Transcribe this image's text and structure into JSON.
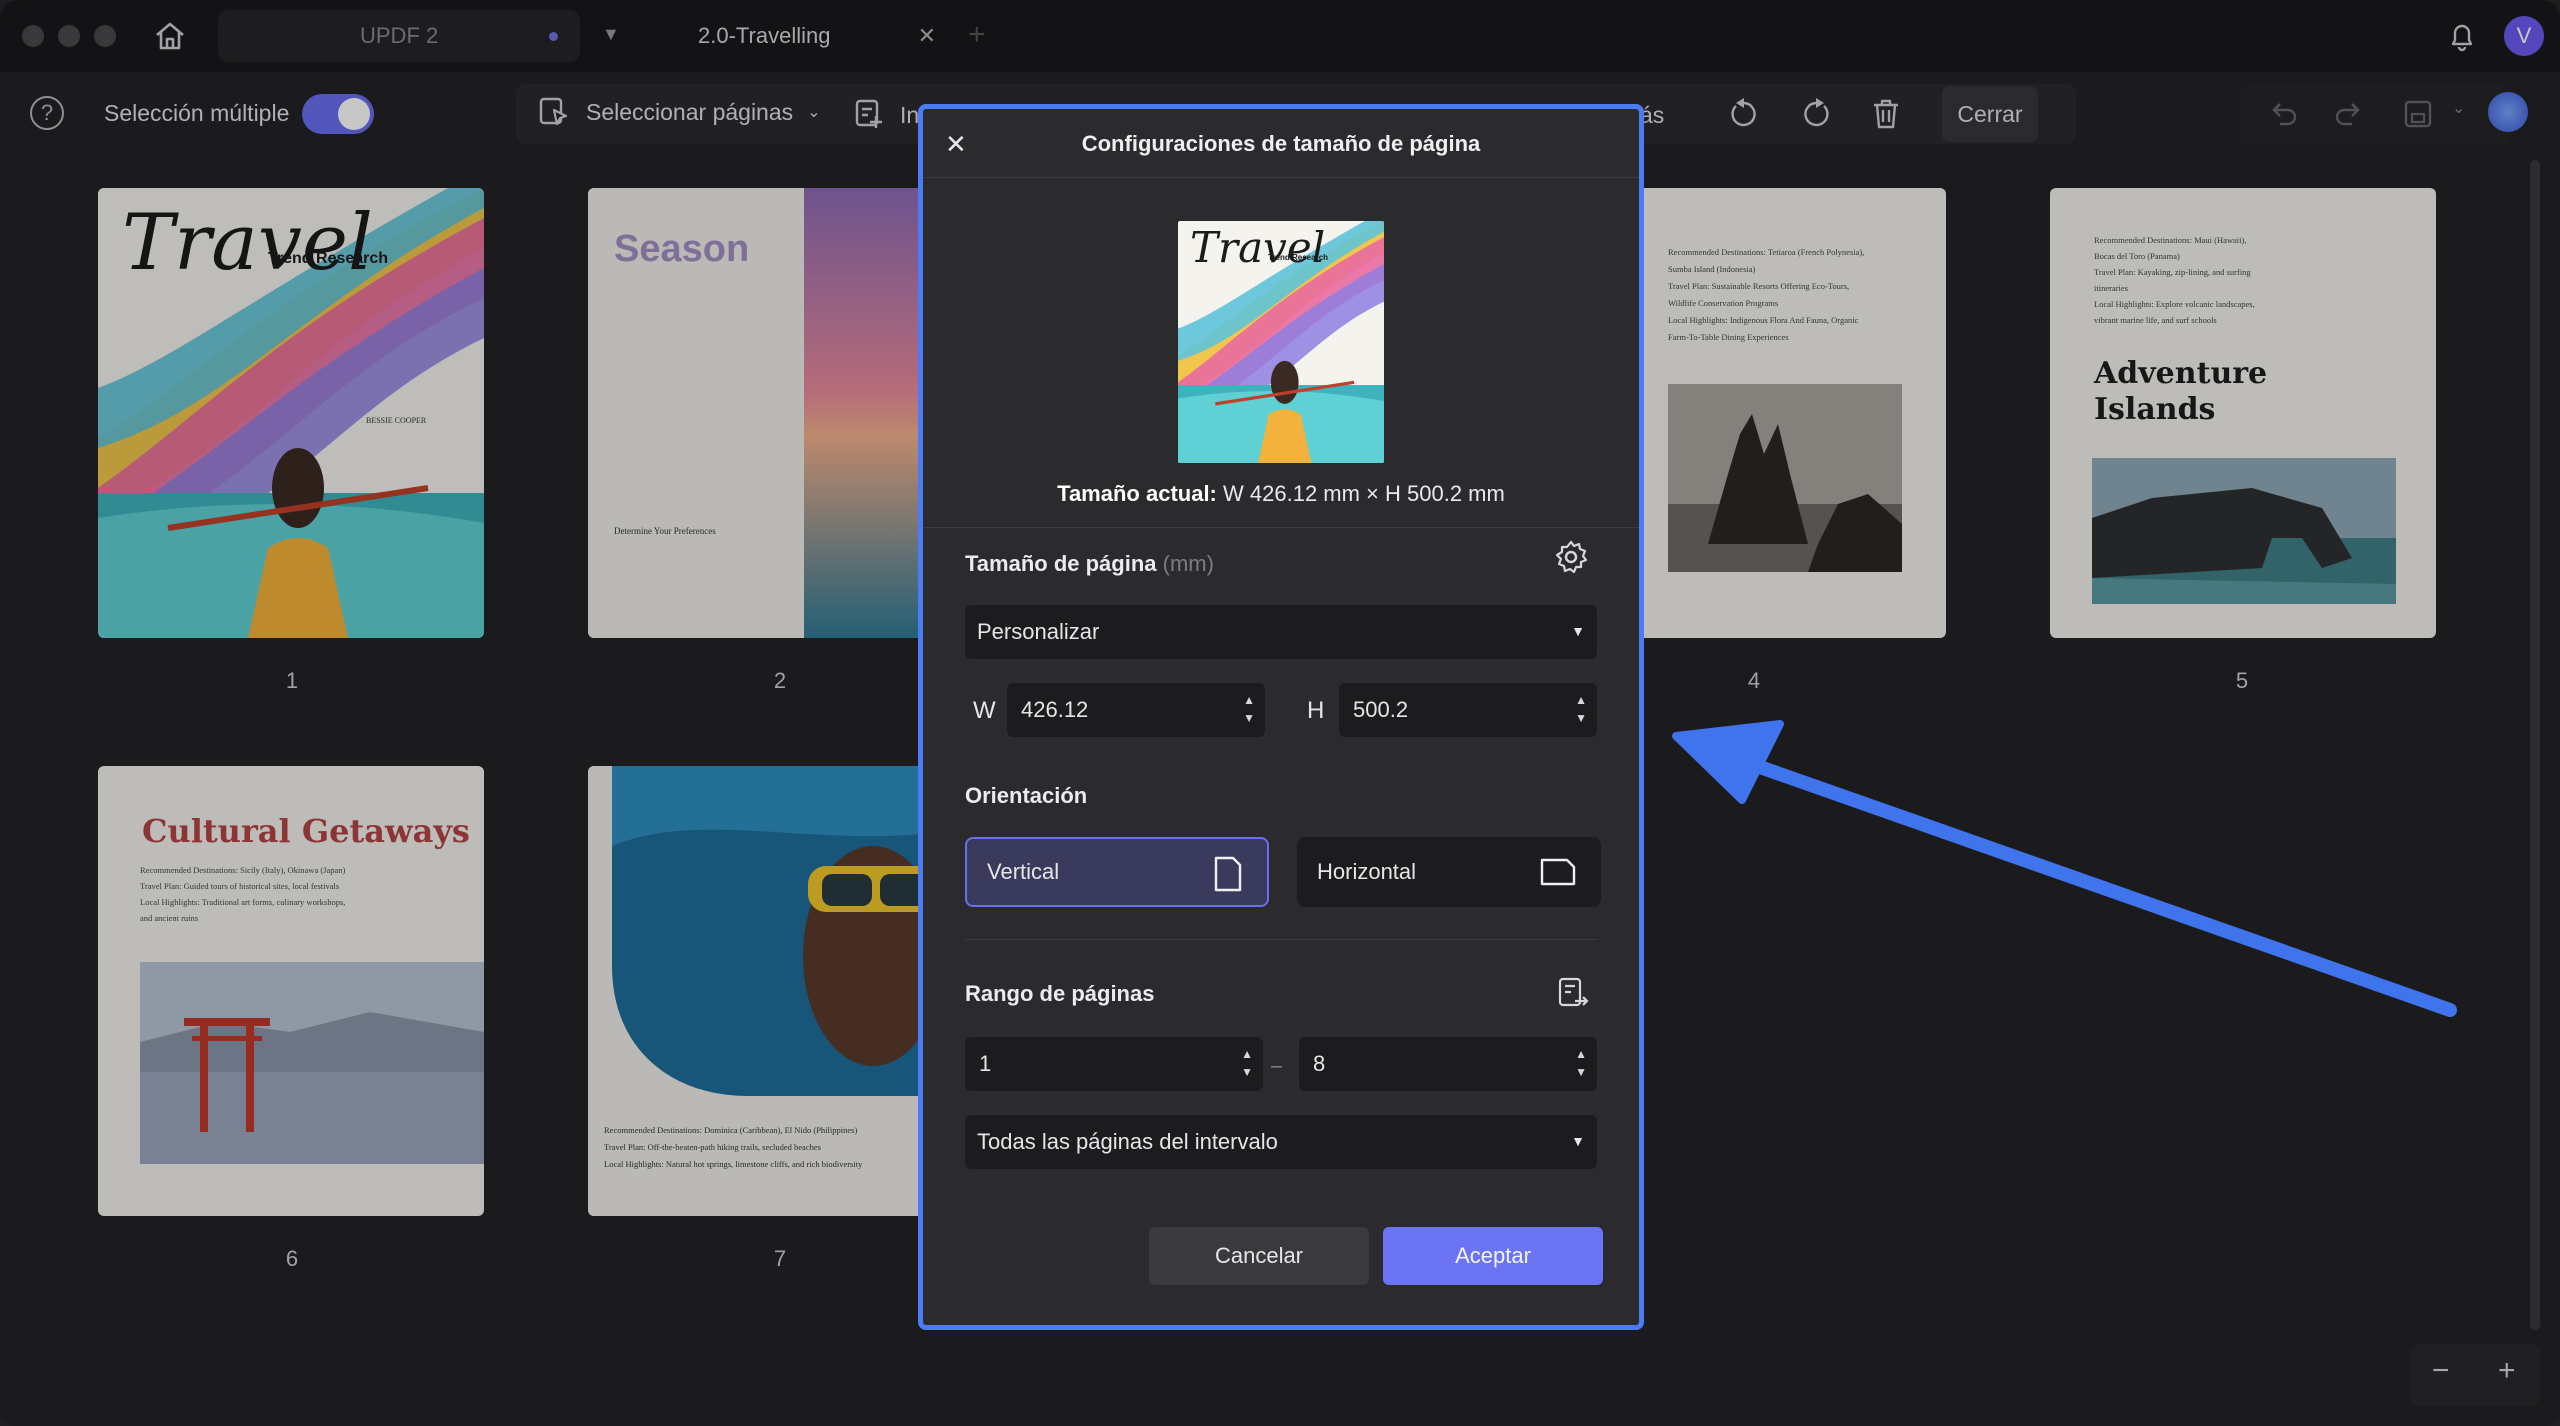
{
  "titlebar": {
    "tabs": [
      {
        "label": "UPDF 2"
      },
      {
        "label": "2.0-Travelling"
      }
    ],
    "avatar_initial": "V"
  },
  "toolbar": {
    "multi_select_label": "Selección múltiple",
    "select_pages_label": "Seleccionar páginas",
    "insert_partial": "In",
    "more_partial": "ás",
    "close_label": "Cerrar"
  },
  "pages": [
    {
      "number": "1"
    },
    {
      "number": "2"
    },
    {
      "number": "4"
    },
    {
      "number": "5"
    },
    {
      "number": "6"
    },
    {
      "number": "7"
    }
  ],
  "page_content": {
    "p1_script_title": "Travel",
    "p1_trend": "Trend Research",
    "p1_author": "BESSIE COOPER",
    "p2_title": "Season",
    "p2_heading": "Determine Your Preferences",
    "p4_lines": [
      "Recommended Destinations: Tetiaroa (French Polynesia),",
      "Sumba Island (Indonesia)",
      "Travel Plan: Sustainable Resorts Offering Eco-Tours,",
      "Wildlife Conservation Programs",
      "Local Highlights: Indigenous Flora And Fauna, Organic",
      "Farm-To-Table Dining Experiences"
    ],
    "p5_lines": [
      "Recommended Destinations: Maui (Hawaii),",
      "Bocas del Toro (Panama)",
      "Travel Plan: Kayaking, zip-lining, and surfing",
      "itineraries",
      "Local Highlights: Explore volcanic landscapes,",
      "vibrant marine life, and surf schools"
    ],
    "p5_title_1": "Adventure",
    "p5_title_2": "Islands",
    "p6_title": "Cultural Getaways",
    "p6_lines": [
      "Recommended Destinations: Sicily (Italy), Okinawa (Japan)",
      "Travel Plan: Guided tours of historical sites, local festivals",
      "Local Highlights: Traditional art forms, culinary workshops,",
      "and ancient ruins"
    ],
    "p7_lines": [
      "Recommended Destinations: Dominica (Caribbean), El Nido (Philippines)",
      "Travel Plan: Off-the-beaten-path hiking trails, secluded beaches",
      "Local Highlights: Natural hot springs, limestone cliffs, and rich biodiversity"
    ]
  },
  "dialog": {
    "title": "Configuraciones de tamaño de página",
    "current_size_label": "Tamaño actual:",
    "current_size_value": "W 426.12 mm × H 500.2 mm",
    "page_size_label": "Tamaño de página",
    "page_size_unit": "(mm)",
    "size_preset": "Personalizar",
    "w_label": "W",
    "w_value": "426.12",
    "h_label": "H",
    "h_value": "500.2",
    "orientation_label": "Orientación",
    "orientation_vertical": "Vertical",
    "orientation_horizontal": "Horizontal",
    "orientation_selected": "Vertical",
    "range_label": "Rango de páginas",
    "range_from": "1",
    "range_to": "8",
    "range_mode": "Todas las páginas del intervalo",
    "cancel_label": "Cancelar",
    "accept_label": "Aceptar"
  },
  "colors": {
    "accent": "#6a74f5",
    "dialog_border": "#4b7cf5",
    "arrow": "#3f74ec"
  },
  "zoom": {
    "minus": "−",
    "plus": "+"
  }
}
